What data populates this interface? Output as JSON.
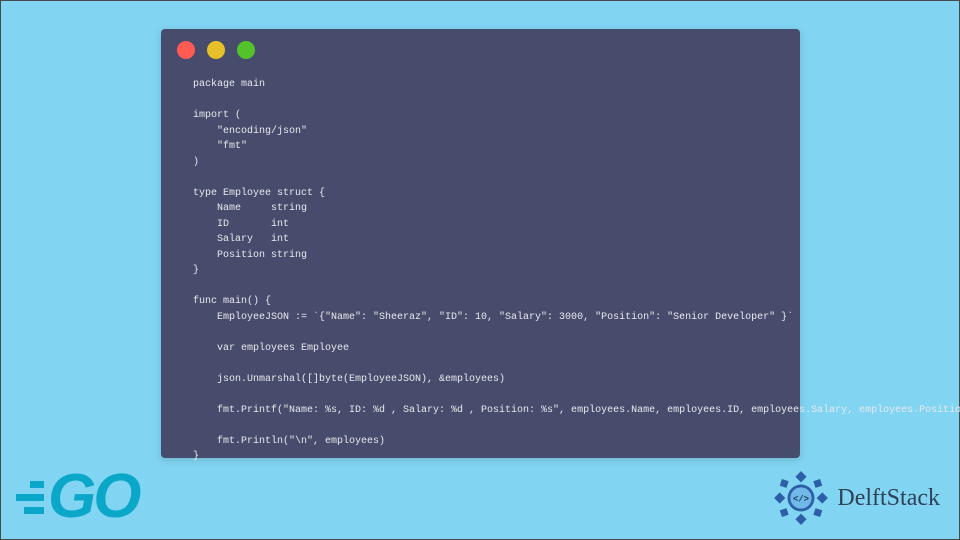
{
  "window": {
    "dots": [
      "close",
      "minimize",
      "maximize"
    ]
  },
  "code": {
    "lines": [
      "package main",
      "",
      "import (",
      "    \"encoding/json\"",
      "    \"fmt\"",
      ")",
      "",
      "type Employee struct {",
      "    Name     string",
      "    ID       int",
      "    Salary   int",
      "    Position string",
      "}",
      "",
      "func main() {",
      "    EmployeeJSON := `{\"Name\": \"Sheeraz\", \"ID\": 10, \"Salary\": 3000, \"Position\": \"Senior Developer\" }`",
      "",
      "    var employees Employee",
      "",
      "    json.Unmarshal([]byte(EmployeeJSON), &employees)",
      "",
      "    fmt.Printf(\"Name: %s, ID: %d , Salary: %d , Position: %s\", employees.Name, employees.ID, employees.Salary, employees.Position)",
      "",
      "    fmt.Println(\"\\n\", employees)",
      "}"
    ]
  },
  "logos": {
    "go": "GO",
    "brand": "DelftStack"
  },
  "colors": {
    "bg": "#81d4f2",
    "window": "#474c6c",
    "go": "#0aa7c9",
    "brand_badge": "#2d5fa6"
  }
}
